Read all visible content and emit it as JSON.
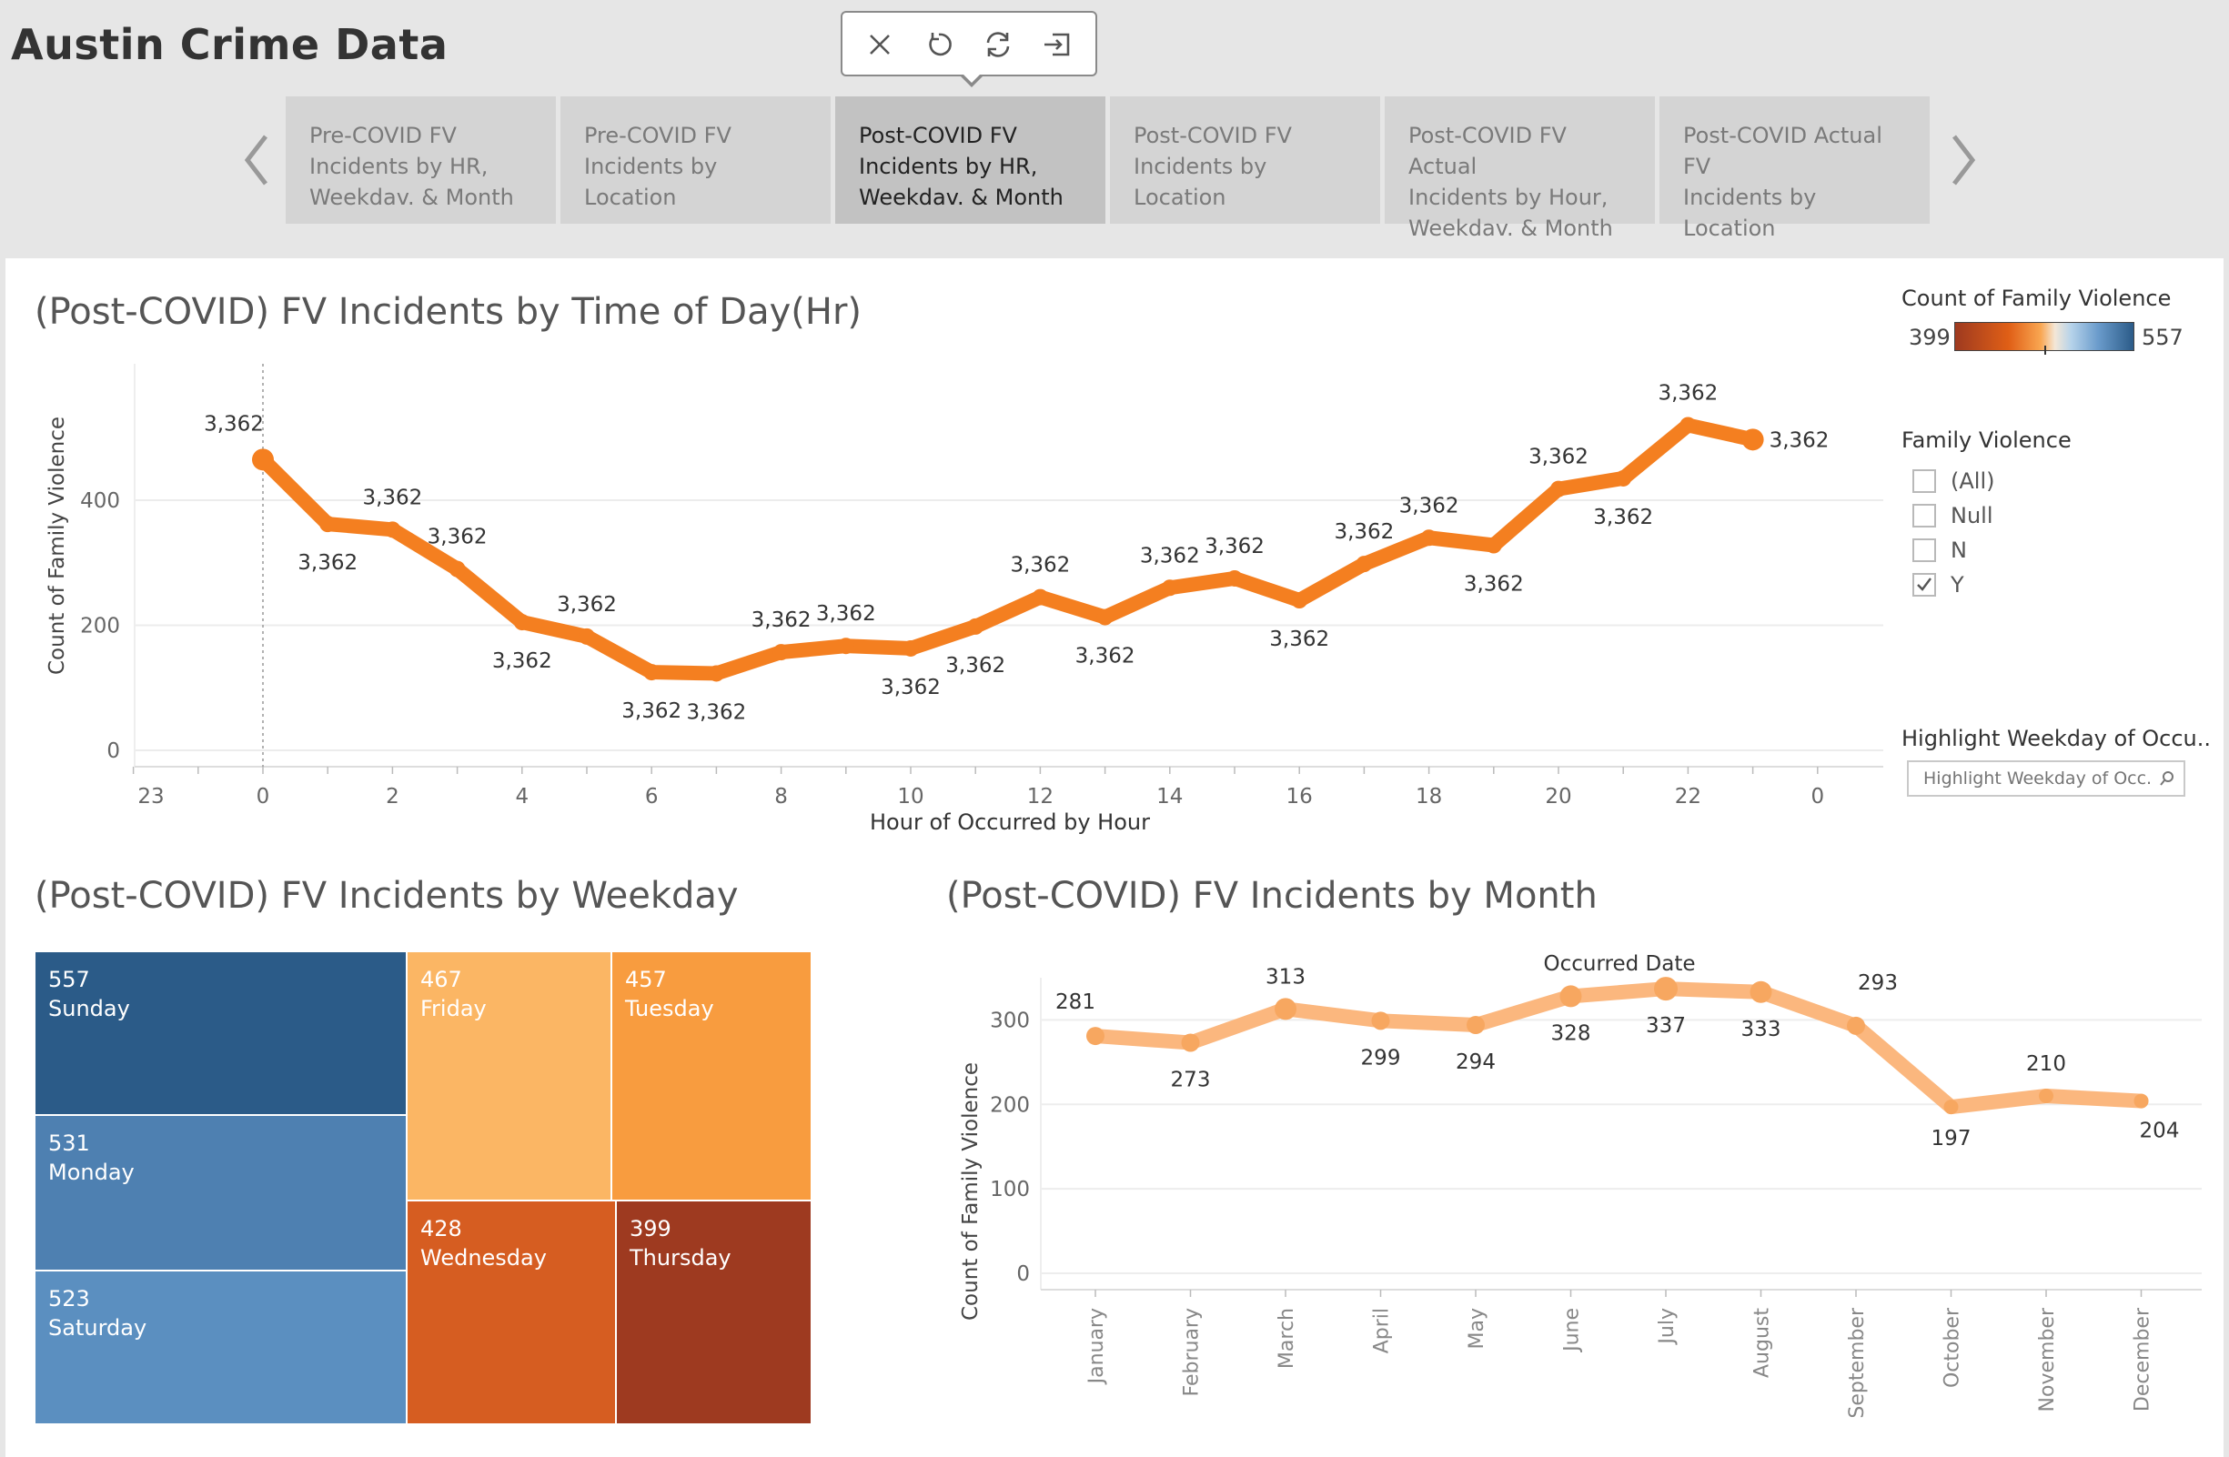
{
  "app": {
    "title": "Austin Crime Data"
  },
  "toolbar": {
    "icons": [
      "close-icon",
      "undo-icon",
      "refresh-icon",
      "exit-icon"
    ]
  },
  "tabs": [
    {
      "line1": "Pre-COVID FV",
      "line2": "Incidents by HR,",
      "line3": "Weekdav. & Month"
    },
    {
      "line1": "Pre-COVID FV",
      "line2": "Incidents by Location",
      "line3": ""
    },
    {
      "line1": "Post-COVID FV",
      "line2": "Incidents by HR,",
      "line3": "Weekdav. & Month"
    },
    {
      "line1": "Post-COVID FV",
      "line2": "Incidents by Location",
      "line3": ""
    },
    {
      "line1": "Post-COVID FV Actual",
      "line2": "Incidents by Hour,",
      "line3": "Weekdav. & Month"
    },
    {
      "line1": "Post-COVID Actual FV",
      "line2": "Incidents by Location",
      "line3": ""
    }
  ],
  "active_tab": 2,
  "colors": {
    "accent_orange": "#f47f20",
    "light_orange": "#fbb77e",
    "blue_dark": "#2b5b88",
    "blue_mid": "#4e80b1",
    "blue_light": "#5b8fc0"
  },
  "legend": {
    "color_title": "Count of Family Violence",
    "color_min": "399",
    "color_max": "557",
    "filter_title": "Family Violence",
    "filter_options": [
      {
        "label": "(All)",
        "checked": false
      },
      {
        "label": "Null",
        "checked": false
      },
      {
        "label": "N",
        "checked": false
      },
      {
        "label": "Y",
        "checked": true
      }
    ],
    "highlight_title": "Highlight Weekday of Occu..",
    "highlight_placeholder": "Highlight Weekday of Occ..."
  },
  "hour_chart": {
    "title": "(Post-COVID) FV Incidents by Time of Day(Hr)",
    "xlabel": "Hour of Occurred by Hour",
    "ylabel": "Count of Family Violence",
    "point_label": "3,362"
  },
  "weekday_chart": {
    "title": "(Post-COVID) FV Incidents by Weekday"
  },
  "month_chart": {
    "title": "(Post-COVID) FV Incidents by Month",
    "header": "Occurred Date",
    "ylabel": "Count of Family Violence"
  },
  "chart_data": [
    {
      "type": "line",
      "title": "(Post-COVID) FV Incidents by Time of Day(Hr)",
      "xlabel": "Hour of Occurred by Hour",
      "ylabel": "Count of Family Violence",
      "x": [
        0,
        1,
        2,
        3,
        4,
        5,
        6,
        7,
        8,
        9,
        10,
        11,
        12,
        13,
        14,
        15,
        16,
        17,
        18,
        19,
        20,
        21,
        22,
        23
      ],
      "values": [
        465,
        362,
        353,
        290,
        205,
        182,
        125,
        123,
        157,
        167,
        163,
        198,
        245,
        213,
        260,
        275,
        240,
        298,
        340,
        328,
        418,
        435,
        520,
        497
      ],
      "x_ticks": [
        "23",
        "0",
        "2",
        "4",
        "6",
        "8",
        "10",
        "12",
        "14",
        "16",
        "18",
        "20",
        "22",
        "0"
      ],
      "y_ticks": [
        0,
        200,
        400
      ],
      "ylim": [
        0,
        560
      ],
      "data_label": "3,362",
      "grid": true
    },
    {
      "type": "treemap",
      "title": "(Post-COVID) FV Incidents by Weekday",
      "categories": [
        "Sunday",
        "Monday",
        "Saturday",
        "Friday",
        "Tuesday",
        "Wednesday",
        "Thursday"
      ],
      "values": [
        557,
        531,
        523,
        467,
        457,
        428,
        399
      ],
      "colors": [
        "#2b5b88",
        "#4e80b1",
        "#5b8fc0",
        "#fbb664",
        "#f89c3f",
        "#d65d21",
        "#9e3a20"
      ]
    },
    {
      "type": "line",
      "title": "(Post-COVID) FV Incidents by Month",
      "xlabel": "Occurred Date",
      "ylabel": "Count of Family Violence",
      "categories": [
        "January",
        "February",
        "March",
        "April",
        "May",
        "June",
        "July",
        "August",
        "September",
        "October",
        "November",
        "December"
      ],
      "values": [
        281,
        273,
        313,
        299,
        294,
        328,
        337,
        333,
        293,
        197,
        210,
        204
      ],
      "y_ticks": [
        0,
        100,
        200,
        300
      ],
      "ylim": [
        0,
        350
      ],
      "grid": true
    }
  ]
}
